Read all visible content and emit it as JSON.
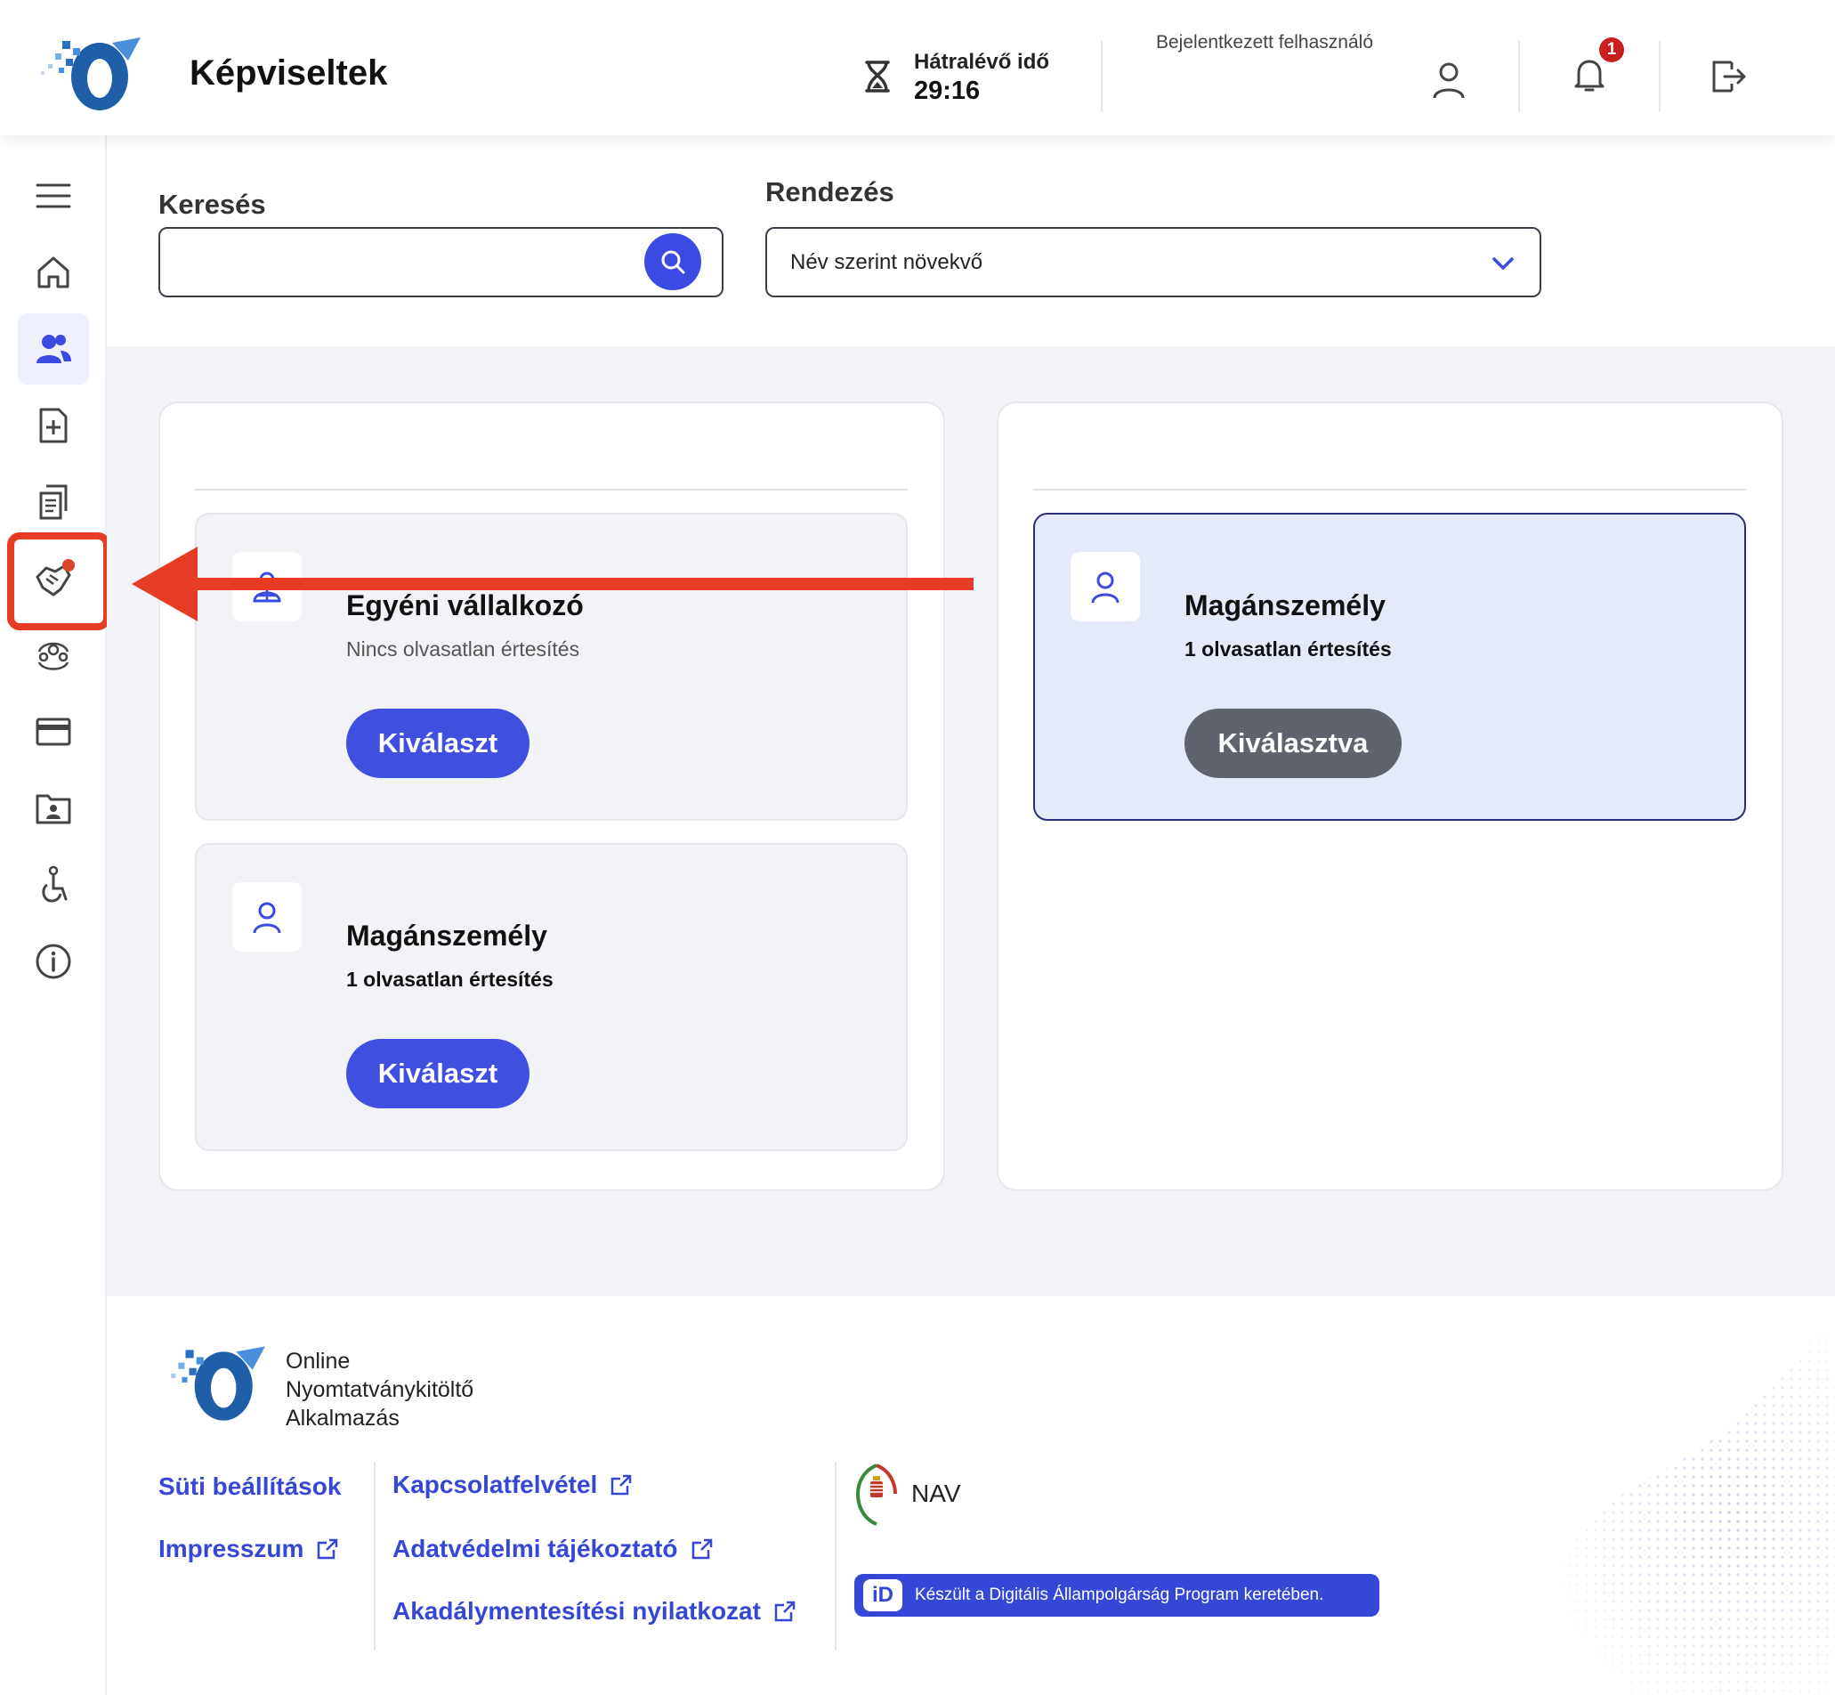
{
  "header": {
    "title": "Képviseltek",
    "timer_label": "Hátralévő idő",
    "timer_value": "29:16",
    "user_label": "Bejelentkezett felhasználó",
    "notification_count": "1"
  },
  "sidebar": {
    "items": [
      {
        "icon": "menu-icon"
      },
      {
        "icon": "home-icon"
      },
      {
        "icon": "users-icon",
        "active": true
      },
      {
        "icon": "new-document-icon"
      },
      {
        "icon": "documents-icon"
      },
      {
        "icon": "handshake-icon",
        "highlighted": true
      },
      {
        "icon": "people-circle-icon"
      },
      {
        "icon": "card-icon"
      },
      {
        "icon": "contact-folder-icon"
      },
      {
        "icon": "accessibility-icon"
      },
      {
        "icon": "info-icon"
      }
    ]
  },
  "filters": {
    "search_label": "Keresés",
    "search_value": "",
    "sort_label": "Rendezés",
    "sort_value": "Név szerint növekvő"
  },
  "left_panel": {
    "cards": [
      {
        "title": "Egyéni vállalkozó",
        "subtitle": "Nincs olvasatlan értesítés",
        "button": "Kiválaszt"
      },
      {
        "title": "Magánszemély",
        "subtitle": "1 olvasatlan értesítés",
        "button": "Kiválaszt"
      }
    ]
  },
  "right_panel": {
    "cards": [
      {
        "title": "Magánszemély",
        "subtitle": "1 olvasatlan értesítés",
        "button": "Kiválasztva"
      }
    ]
  },
  "footer": {
    "app_name_line1": "Online",
    "app_name_line2": "Nyomtatványkitöltő",
    "app_name_line3": "Alkalmazás",
    "links": {
      "cookies": "Süti beállítások",
      "imprint": "Impresszum",
      "contact": "Kapcsolatfelvétel",
      "privacy": "Adatvédelmi tájékoztató",
      "accessibility": "Akadálymentesítési nyilatkozat"
    },
    "nav": "NAV",
    "dap_text": "Készült a Digitális Állampolgárság Program keretében.",
    "dap_icon_text": "iD"
  },
  "colors": {
    "accent": "#3f4fe0",
    "annotation": "#e63c25",
    "selected_card_bg": "#e5eaf9"
  }
}
